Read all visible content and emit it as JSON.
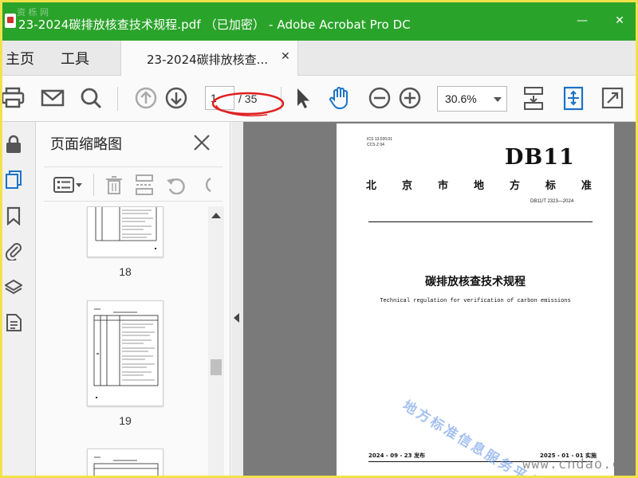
{
  "window": {
    "title": "23-2024碳排放核查技术规程.pdf （已加密） - Adobe Acrobat Pro DC",
    "watermark_corner": "资 栎 网",
    "minimize_glyph": "—",
    "close_glyph": "✕"
  },
  "tabs": {
    "home_label": "主页",
    "tools_label": "工具",
    "document_label": "23-2024碳排放核查...",
    "document_close": "✕"
  },
  "toolbar": {
    "current_page": "1",
    "total_pages": "/ 35",
    "zoom_value": "30.6%",
    "annotation_color": "#e02020"
  },
  "thumbnail_panel": {
    "heading": "页面缩略图",
    "pages": [
      {
        "label": "18"
      },
      {
        "label": "19"
      }
    ]
  },
  "document": {
    "ics_line1": "ICS 13.020.01",
    "ics_line2": "CCS Z 04",
    "standard_mark": "DB11",
    "issuer_chars": [
      "北",
      "京",
      "市",
      "地",
      "方",
      "标",
      "准"
    ],
    "standard_code": "DB11/T 2323—2024",
    "title_cn": "碳排放核查技术规程",
    "title_en": "Technical regulation for verification of carbon emissions",
    "release": "2024 - 09 - 23 发布",
    "implement": "2025 - 01 - 01 实施"
  },
  "watermarks": {
    "diagonal_text": "地方标准信息服务平台",
    "url_text": "www.cndao.c"
  },
  "colors": {
    "titlebar": "#2aa32a",
    "accent_blue": "#1a73c8",
    "border_yellow": "#f2e24a"
  }
}
